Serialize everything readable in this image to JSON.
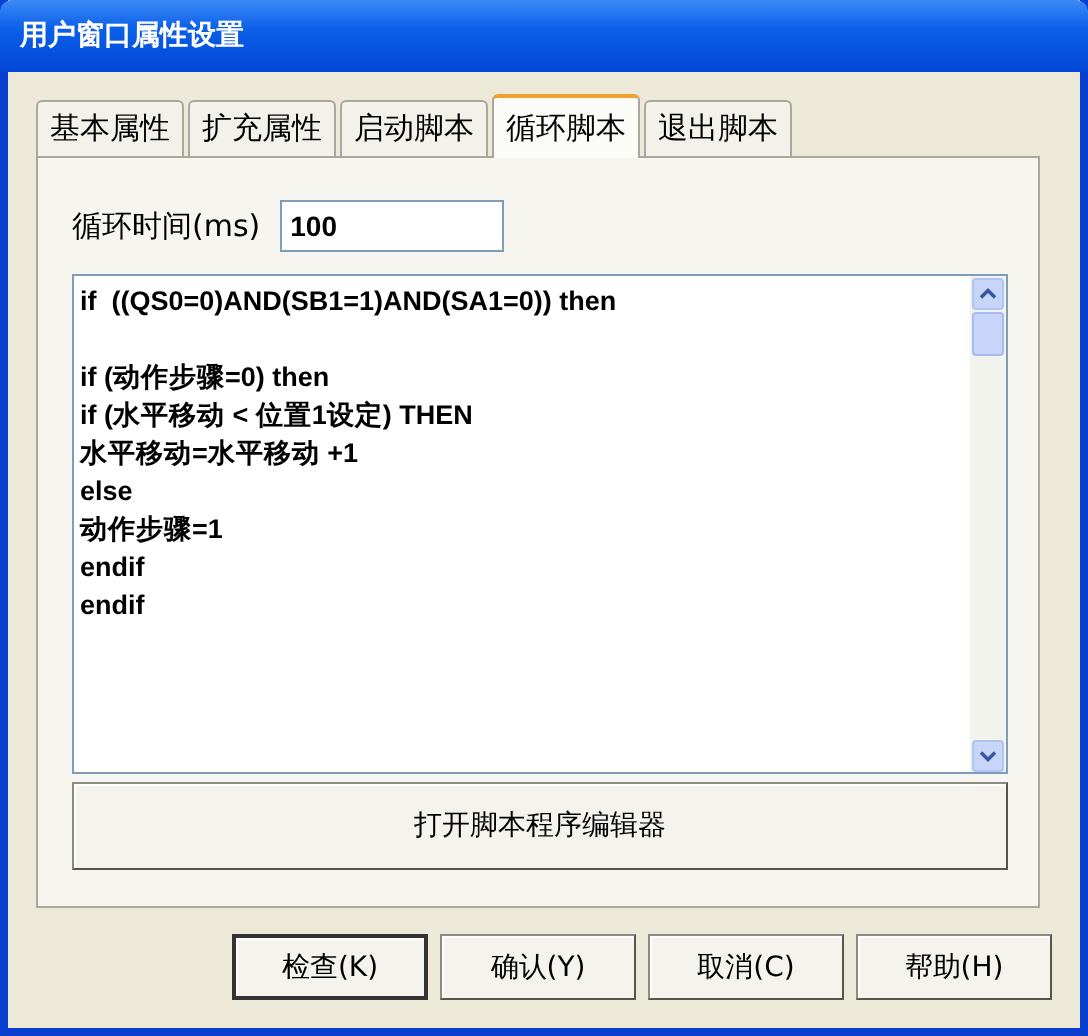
{
  "window": {
    "title": "用户窗口属性设置"
  },
  "tabs": [
    {
      "label": "基本属性",
      "selected": false
    },
    {
      "label": "扩充属性",
      "selected": false
    },
    {
      "label": "启动脚本",
      "selected": false
    },
    {
      "label": "循环脚本",
      "selected": true
    },
    {
      "label": "退出脚本",
      "selected": false
    }
  ],
  "cycle_time": {
    "label": "循环时间(ms)",
    "value": "100"
  },
  "script_editor": {
    "value": "if  ((QS0=0)AND(SB1=1)AND(SA1=0)) then\n\nif (动作步骤=0) then\nif (水平移动 < 位置1设定) THEN\n水平移动=水平移动 +1\nelse\n动作步骤=1\nendif\nendif"
  },
  "open_editor_button": "打开脚本程序编辑器",
  "buttons": [
    {
      "label": "检查(K)",
      "default": true
    },
    {
      "label": "确认(Y)",
      "default": false
    },
    {
      "label": "取消(C)",
      "default": false
    },
    {
      "label": "帮助(H)",
      "default": false
    }
  ]
}
